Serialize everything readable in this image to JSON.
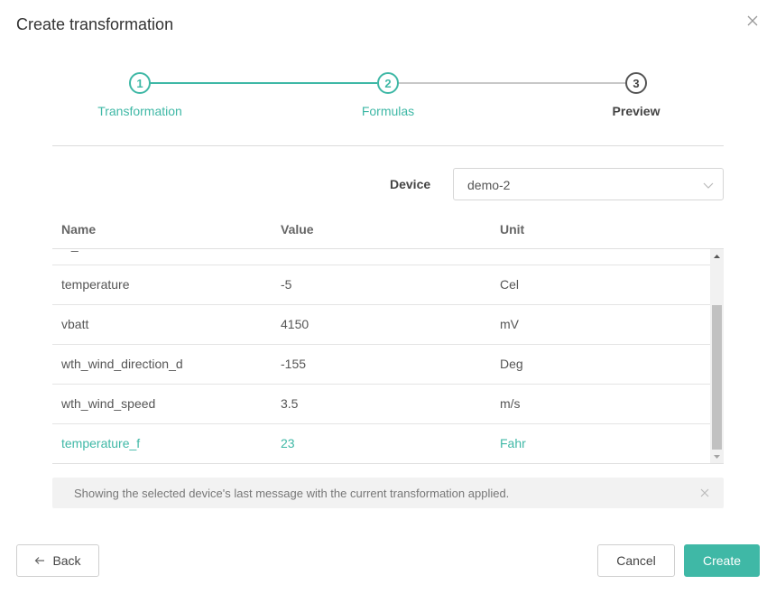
{
  "modal": {
    "title": "Create transformation"
  },
  "stepper": {
    "steps": [
      {
        "number": "1",
        "label": "Transformation",
        "state": "completed"
      },
      {
        "number": "2",
        "label": "Formulas",
        "state": "completed"
      },
      {
        "number": "3",
        "label": "Preview",
        "state": "active"
      }
    ]
  },
  "device": {
    "label": "Device",
    "selected": "demo-2"
  },
  "table": {
    "headers": {
      "name": "Name",
      "value": "Value",
      "unit": "Unit"
    },
    "rows": [
      {
        "name": "sf_ff",
        "value": "",
        "unit": ""
      },
      {
        "name": "temperature",
        "value": "-5",
        "unit": "Cel"
      },
      {
        "name": "vbatt",
        "value": "4150",
        "unit": "mV"
      },
      {
        "name": "wth_wind_direction_d",
        "value": "-155",
        "unit": "Deg"
      },
      {
        "name": "wth_wind_speed",
        "value": "3.5",
        "unit": "m/s"
      },
      {
        "name": "temperature_f",
        "value": "23",
        "unit": "Fahr"
      }
    ]
  },
  "info": {
    "text": "Showing the selected device's last message with the current transformation applied."
  },
  "footer": {
    "back_label": "Back",
    "cancel_label": "Cancel",
    "create_label": "Create"
  },
  "colors": {
    "accent": "#3fb8a6",
    "inactive_line": "#c8c8c8"
  }
}
